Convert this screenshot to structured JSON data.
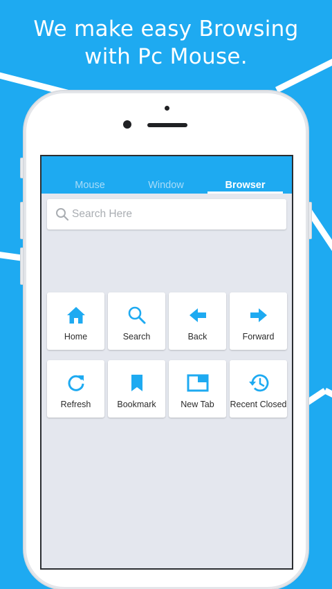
{
  "headline": {
    "line1": "We make easy Browsing",
    "line2": "with Pc Mouse."
  },
  "colors": {
    "accent": "#1eaaf1",
    "screen_bg": "#e4e7ee",
    "tab_inactive": "#a9dcf8",
    "label": "#2b2b2b"
  },
  "tabs": [
    {
      "label": "Mouse",
      "active": false
    },
    {
      "label": "Window",
      "active": false
    },
    {
      "label": "Browser",
      "active": true
    }
  ],
  "search": {
    "placeholder": "Search Here",
    "icon": "search-icon"
  },
  "actions": [
    {
      "label": "Home",
      "icon": "home-icon"
    },
    {
      "label": "Search",
      "icon": "search-icon"
    },
    {
      "label": "Back",
      "icon": "arrow-left-icon"
    },
    {
      "label": "Forward",
      "icon": "arrow-right-icon"
    },
    {
      "label": "Refresh",
      "icon": "refresh-icon"
    },
    {
      "label": "Bookmark",
      "icon": "bookmark-icon"
    },
    {
      "label": "New Tab",
      "icon": "new-tab-icon"
    },
    {
      "label": "Recent Closed",
      "icon": "history-icon"
    }
  ]
}
